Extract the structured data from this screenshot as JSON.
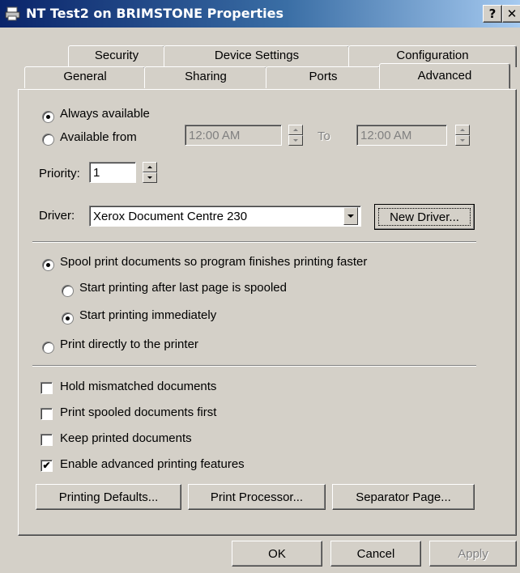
{
  "window": {
    "title": "NT Test2 on BRIMSTONE Properties",
    "help_button": "?",
    "close_button": "✕"
  },
  "tabs": {
    "row1": [
      "Security",
      "Device Settings",
      "Configuration"
    ],
    "row2": [
      "General",
      "Sharing",
      "Ports",
      "Advanced"
    ],
    "active": "Advanced"
  },
  "availability": {
    "always_label": "Always available",
    "always_selected": true,
    "from_label": "Available from",
    "from_time": "12:00 AM",
    "to_label": "To",
    "to_time": "12:00 AM"
  },
  "priority": {
    "label": "Priority:",
    "value": "1"
  },
  "driver": {
    "label": "Driver:",
    "selected": "Xerox Document Centre 230",
    "new_driver_button": "New Driver..."
  },
  "spool": {
    "spool_label": "Spool print documents so program finishes printing faster",
    "spool_selected": true,
    "after_last_page_label": "Start printing after last page is spooled",
    "immediately_label": "Start printing immediately",
    "immediately_selected": true,
    "direct_label": "Print directly to the printer"
  },
  "options": {
    "hold_mismatched": {
      "label": "Hold mismatched documents",
      "checked": false
    },
    "spooled_first": {
      "label": "Print spooled documents first",
      "checked": false
    },
    "keep_printed": {
      "label": "Keep printed documents",
      "checked": false
    },
    "advanced_features": {
      "label": "Enable advanced printing features",
      "checked": true
    }
  },
  "panel_buttons": {
    "printing_defaults": "Printing Defaults...",
    "print_processor": "Print Processor...",
    "separator_page": "Separator Page..."
  },
  "dialog_buttons": {
    "ok": "OK",
    "cancel": "Cancel",
    "apply": "Apply"
  },
  "colors": {
    "face": "#d4d0c8",
    "title_start": "#0a246a",
    "title_end": "#a6caf0"
  }
}
